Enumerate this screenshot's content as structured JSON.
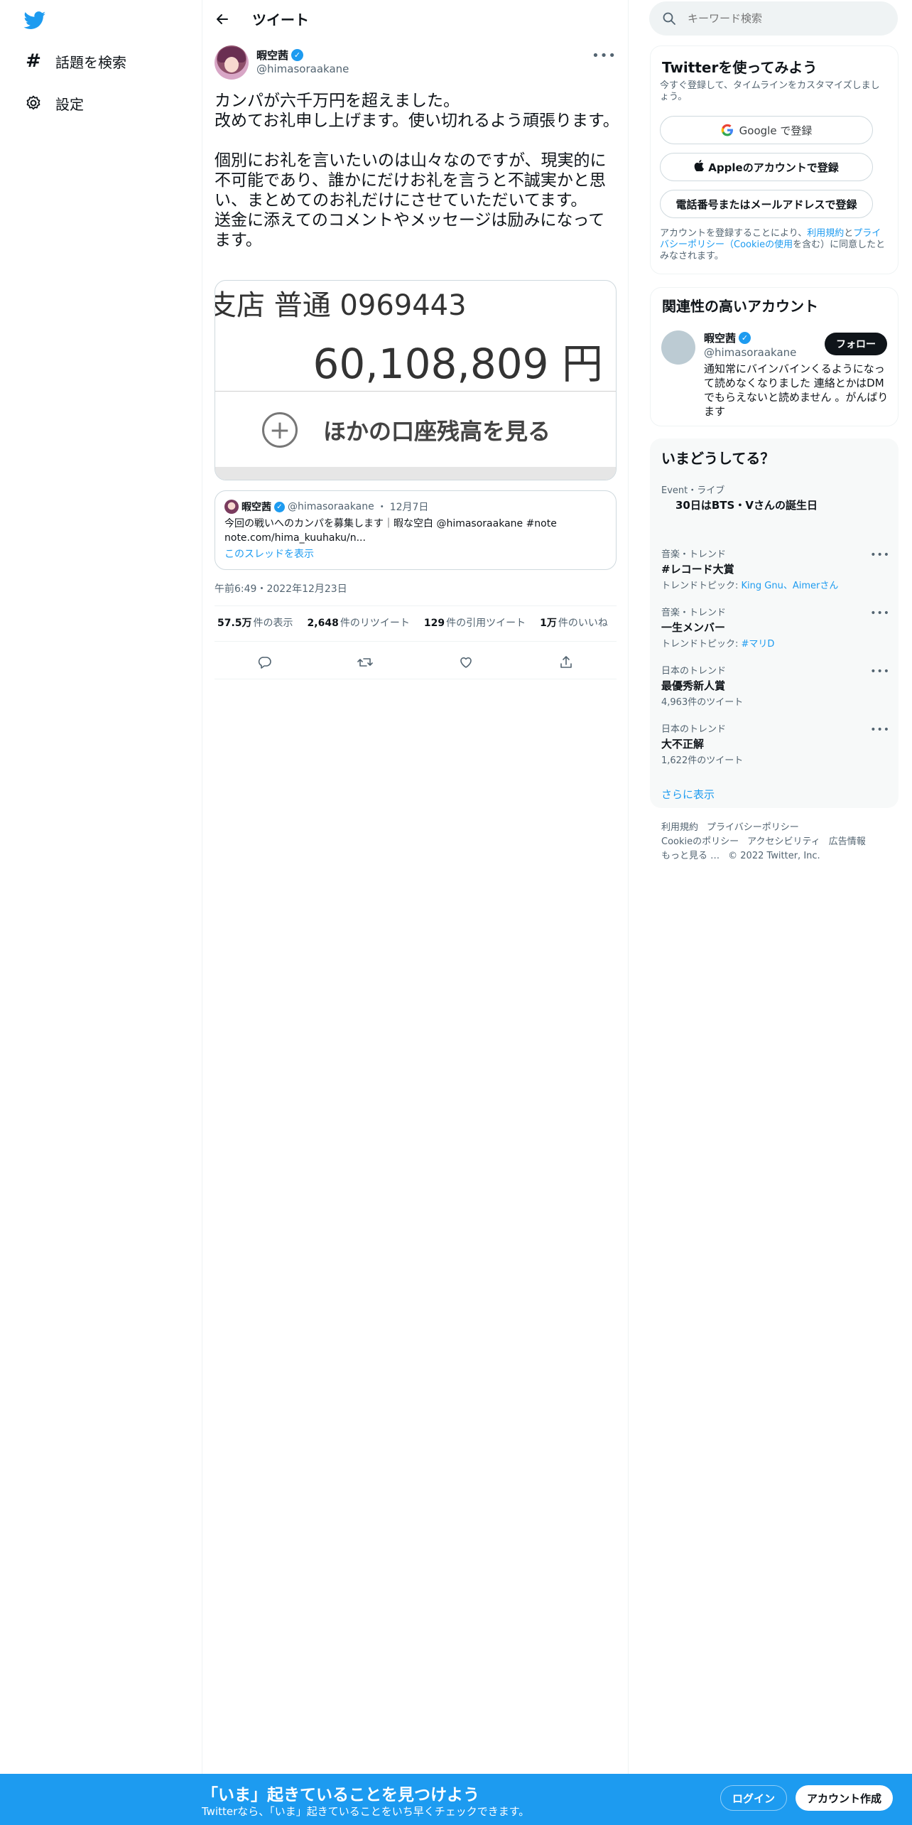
{
  "nav": {
    "logo": "twitter-bird-icon",
    "items": [
      {
        "label": "話題を検索",
        "icon": "hashtag-icon"
      },
      {
        "label": "設定",
        "icon": "gear-icon"
      }
    ]
  },
  "header": {
    "title": "ツイート"
  },
  "tweet": {
    "author_name": "暇空茜",
    "author_handle": "@himasoraakane",
    "text": "カンパが六千万円を超えました。\n改めてお礼申し上げます。使い切れるよう頑張ります。\n\n個別にお礼を言いたいのは山々なのですが、現実的に不可能であり、誰かにだけお礼を言うと不誠実かと思い、まとめてのお礼だけにさせていただいてます。\n送金に添えてのコメントやメッセージは励みになってます。",
    "media": {
      "account_line": "支店 普通 0969443",
      "balance": "60,108,809 円",
      "other_label": "ほかの口座残高を見る"
    },
    "quote": {
      "name": "暇空茜",
      "handle": "@himasoraakane",
      "dot": "・",
      "date": "12月7日",
      "text": "今回の戦いへのカンパを募集します｜暇な空白 @himasoraakane #note note.com/hima_kuuhaku/n...",
      "thread_link": "このスレッドを表示"
    },
    "timestamp": "午前6:49・2022年12月23日",
    "stats": [
      {
        "value": "57.5万",
        "label": "件の表示"
      },
      {
        "value": "2,648",
        "label": "件のリツイート"
      },
      {
        "value": "129",
        "label": "件の引用ツイート"
      },
      {
        "value": "1万",
        "label": "件のいいね"
      }
    ]
  },
  "search": {
    "placeholder": "キーワード検索"
  },
  "signup_card": {
    "title": "Twitterを使ってみよう",
    "subtitle": "今すぐ登録して、タイムラインをカスタマイズしましょう。",
    "google": "Google で登録",
    "apple": "Appleのアカウントで登録",
    "phone": "電話番号またはメールアドレスで登録",
    "legal_prefix": "アカウントを登録することにより、",
    "legal_terms": "利用規約",
    "legal_and": "と",
    "legal_privacy": "プライバシーポリシー",
    "legal_cookie": "（Cookieの使用",
    "legal_suffix": "を含む）に同意したとみなされます。"
  },
  "related": {
    "title": "関連性の高いアカウント",
    "name": "暇空茜",
    "handle": "@himasoraakane",
    "follow": "フォロー",
    "bio": "通知常にバインバインくるようになって読めなくなりました 連絡とかはDMでもらえないと読めません 。がんばります"
  },
  "trends": {
    "title": "いまどうしてる？",
    "items": [
      {
        "meta": "Event・ライブ",
        "name": "30日はBTS・Vさんの誕生日",
        "sub": ""
      },
      {
        "meta": "音楽・トレンド",
        "name": "#レコード大賞",
        "sub_prefix": "トレンドトピック: ",
        "sub_links": "King Gnu、Aimerさん"
      },
      {
        "meta": "音楽・トレンド",
        "name": "一生メンバー",
        "sub_prefix": "トレンドトピック: ",
        "sub_links": "#マリD"
      },
      {
        "meta": "日本のトレンド",
        "name": "最優秀新人賞",
        "sub": "4,963件のツイート"
      },
      {
        "meta": "日本のトレンド",
        "name": "大不正解",
        "sub": "1,622件のツイート"
      }
    ],
    "show_more": "さらに表示"
  },
  "footer": {
    "links": [
      "利用規約",
      "プライバシーポリシー",
      "Cookieのポリシー",
      "アクセシビリティ",
      "広告情報",
      "もっと見る …",
      "© 2022 Twitter, Inc."
    ]
  },
  "banner": {
    "title": "「いま」起きていることを見つけよう",
    "subtitle": "Twitterなら、「いま」起きていることをいち早くチェックできます。",
    "login": "ログイン",
    "signup": "アカウント作成"
  },
  "colors": {
    "accent": "#1d9bf0",
    "text": "#0f1419",
    "muted": "#536471"
  }
}
